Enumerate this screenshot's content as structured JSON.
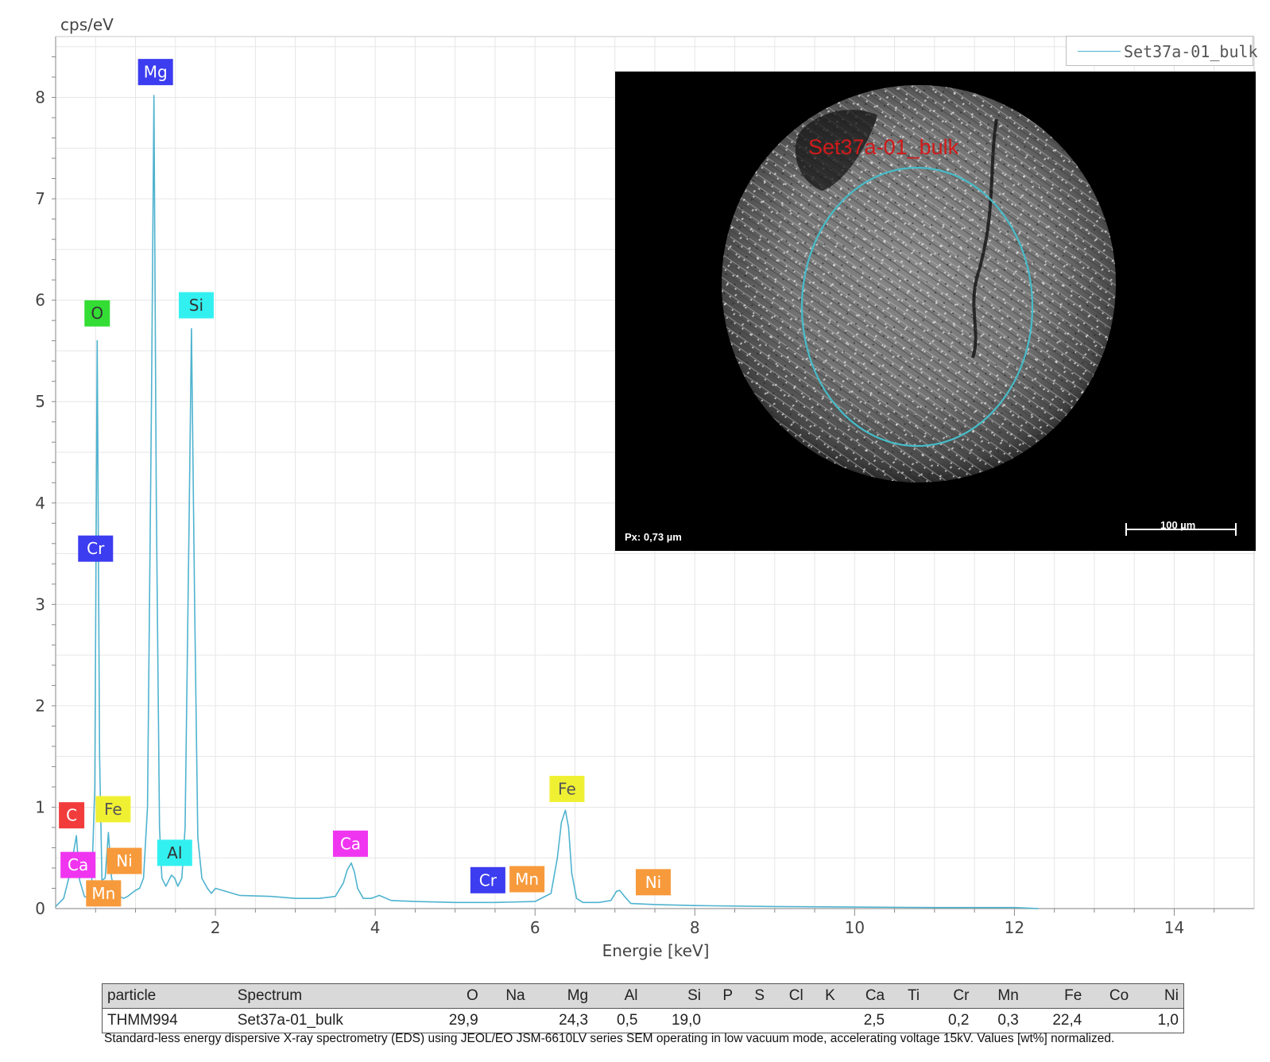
{
  "chart_data": {
    "type": "line",
    "ylabel": "cps/eV",
    "xlabel": "Energie [keV]",
    "xlim": [
      0,
      15
    ],
    "ylim": [
      0,
      8.6
    ],
    "x_ticks": [
      2,
      4,
      6,
      8,
      10,
      12,
      14
    ],
    "y_ticks": [
      0,
      1,
      2,
      3,
      4,
      5,
      6,
      7,
      8
    ],
    "grid": true,
    "legend_position": "top-right",
    "series": [
      {
        "name": "Set37a-01_bulk",
        "color": "#4fb3cf",
        "x": [
          0.0,
          0.1,
          0.18,
          0.26,
          0.3,
          0.36,
          0.42,
          0.45,
          0.49,
          0.52,
          0.55,
          0.58,
          0.62,
          0.66,
          0.7,
          0.75,
          0.8,
          0.85,
          0.9,
          0.95,
          1.0,
          1.05,
          1.1,
          1.15,
          1.2,
          1.23,
          1.26,
          1.3,
          1.33,
          1.38,
          1.45,
          1.49,
          1.53,
          1.58,
          1.62,
          1.67,
          1.7,
          1.74,
          1.78,
          1.83,
          1.9,
          1.95,
          2.0,
          2.3,
          2.7,
          3.0,
          3.3,
          3.5,
          3.6,
          3.65,
          3.7,
          3.74,
          3.78,
          3.85,
          3.95,
          4.05,
          4.2,
          4.5,
          5.0,
          5.5,
          6.0,
          6.2,
          6.28,
          6.33,
          6.38,
          6.42,
          6.46,
          6.52,
          6.6,
          6.8,
          6.95,
          7.02,
          7.06,
          7.12,
          7.2,
          7.5,
          8.0,
          9.0,
          10.0,
          11.0,
          12.0,
          12.3
        ],
        "values": [
          0.02,
          0.1,
          0.35,
          0.72,
          0.28,
          0.12,
          0.1,
          0.2,
          1.2,
          5.6,
          1.5,
          0.28,
          0.3,
          0.75,
          0.3,
          0.15,
          0.12,
          0.1,
          0.12,
          0.15,
          0.18,
          0.2,
          0.3,
          1.0,
          5.0,
          8.02,
          4.0,
          0.8,
          0.3,
          0.22,
          0.33,
          0.3,
          0.22,
          0.3,
          0.8,
          3.8,
          5.72,
          3.0,
          0.7,
          0.3,
          0.2,
          0.15,
          0.2,
          0.13,
          0.12,
          0.1,
          0.1,
          0.12,
          0.25,
          0.38,
          0.45,
          0.36,
          0.2,
          0.1,
          0.1,
          0.13,
          0.08,
          0.07,
          0.06,
          0.06,
          0.07,
          0.15,
          0.5,
          0.85,
          0.97,
          0.8,
          0.35,
          0.1,
          0.06,
          0.06,
          0.08,
          0.17,
          0.18,
          0.12,
          0.05,
          0.04,
          0.03,
          0.02,
          0.015,
          0.01,
          0.01,
          0.0
        ]
      }
    ],
    "element_labels": [
      {
        "text": "Mg",
        "energy": 1.25,
        "height": 8.25,
        "bg": "#3c3cf0",
        "fg": "#ffffff"
      },
      {
        "text": "Si",
        "energy": 1.76,
        "height": 5.95,
        "bg": "#33f0f0",
        "fg": "#333333"
      },
      {
        "text": "O",
        "energy": 0.52,
        "height": 5.87,
        "bg": "#33dd33",
        "fg": "#333333"
      },
      {
        "text": "Cr",
        "energy": 0.5,
        "height": 3.55,
        "bg": "#3c3cf0",
        "fg": "#ffffff"
      },
      {
        "text": "C",
        "energy": 0.2,
        "height": 0.92,
        "bg": "#f23c3c",
        "fg": "#ffffff"
      },
      {
        "text": "Fe",
        "energy": 0.72,
        "height": 0.98,
        "bg": "#f0f033",
        "fg": "#555555"
      },
      {
        "text": "Ca",
        "energy": 0.28,
        "height": 0.43,
        "bg": "#f035f0",
        "fg": "#ffffff"
      },
      {
        "text": "Ni",
        "energy": 0.86,
        "height": 0.47,
        "bg": "#f79a3c",
        "fg": "#ffffff"
      },
      {
        "text": "Mn",
        "energy": 0.6,
        "height": 0.15,
        "bg": "#f79a3c",
        "fg": "#ffffff"
      },
      {
        "text": "Al",
        "energy": 1.49,
        "height": 0.55,
        "bg": "#33f0f0",
        "fg": "#333333"
      },
      {
        "text": "Ca",
        "energy": 3.69,
        "height": 0.64,
        "bg": "#f035f0",
        "fg": "#ffffff"
      },
      {
        "text": "Cr",
        "energy": 5.41,
        "height": 0.28,
        "bg": "#3c3cf0",
        "fg": "#ffffff"
      },
      {
        "text": "Mn",
        "energy": 5.9,
        "height": 0.29,
        "bg": "#f79a3c",
        "fg": "#ffffff"
      },
      {
        "text": "Fe",
        "energy": 6.4,
        "height": 1.18,
        "bg": "#f0f033",
        "fg": "#555555"
      },
      {
        "text": "Ni",
        "energy": 7.48,
        "height": 0.26,
        "bg": "#f79a3c",
        "fg": "#ffffff"
      }
    ]
  },
  "legend": {
    "label": "Set37a-01_bulk"
  },
  "inset": {
    "title": "Set37a-01_bulk",
    "pixel_size": "Px: 0,73 µm",
    "scale_bar": "100 µm"
  },
  "table": {
    "headers": [
      "particle",
      "Spectrum",
      "O",
      "Na",
      "Mg",
      "Al",
      "Si",
      "P",
      "S",
      "Cl",
      "K",
      "Ca",
      "Ti",
      "Cr",
      "Mn",
      "Fe",
      "Co",
      "Ni"
    ],
    "rows": [
      [
        "THMM994",
        "Set37a-01_bulk",
        "29,9",
        "",
        "24,3",
        "0,5",
        "19,0",
        "",
        "",
        "",
        "",
        "2,5",
        "",
        "0,2",
        "0,3",
        "22,4",
        "",
        "1,0"
      ]
    ]
  },
  "footnote": "Standard-less energy dispersive X-ray spectrometry (EDS) using JEOL/EO JSM-6610LV series SEM operating in low vacuum mode, accelerating voltage 15kV. Values [wt%] normalized."
}
